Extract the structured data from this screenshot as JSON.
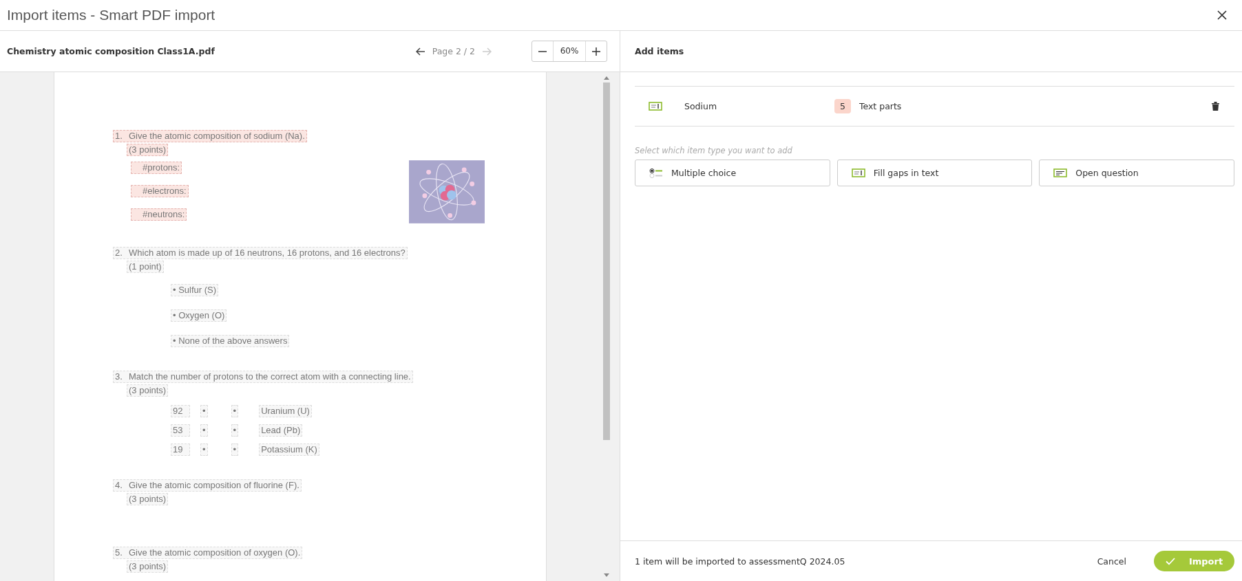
{
  "window": {
    "title": "Import items - Smart PDF import"
  },
  "pdf": {
    "file_name": "Chemistry atomic composition Class1A.pdf",
    "page_label": "Page 2 / 2",
    "prev_disabled": false,
    "next_disabled": true,
    "zoom": "60%",
    "questions": [
      {
        "number": "1.",
        "text": "Give the atomic composition of sodium (Na).",
        "points": "(3 points)",
        "highlighted": true,
        "kind": "gaps",
        "gaps": [
          {
            "label": "#protons:",
            "highlighted": true
          },
          {
            "label": "#electrons:",
            "highlighted": true
          },
          {
            "label": "#neutrons:",
            "highlighted": true
          }
        ]
      },
      {
        "number": "2.",
        "text": "Which atom is made up of 16 neutrons, 16 protons, and 16 electrons?",
        "points": "(1 point)",
        "highlighted": false,
        "kind": "options",
        "options": [
          "• Sulfur (S)",
          "• Oxygen (O)",
          "• None of the above answers"
        ]
      },
      {
        "number": "3.",
        "text": "Match the number of protons to the correct atom with a connecting line.",
        "points": "(3 points)",
        "highlighted": false,
        "kind": "matching",
        "pairs": [
          {
            "number": "92",
            "left_mark": "•",
            "right_mark": "•",
            "atom": "Uranium (U)"
          },
          {
            "number": "53",
            "left_mark": "•",
            "right_mark": "•",
            "atom": "Lead (Pb)"
          },
          {
            "number": "19",
            "left_mark": "•",
            "right_mark": "•",
            "atom": "Potassium (K)"
          }
        ]
      },
      {
        "number": "4.",
        "text": "Give the atomic composition of fluorine (F).",
        "points": "(3 points)",
        "highlighted": false,
        "kind": "plain"
      },
      {
        "number": "5.",
        "text": "Give the atomic composition of oxygen (O).",
        "points": "(3 points)",
        "highlighted": false,
        "kind": "plain"
      }
    ]
  },
  "add_items": {
    "title": "Add items",
    "items": [
      {
        "kind": "fill_gaps",
        "name": "Sodium",
        "count": "5",
        "count_label": "Text parts"
      }
    ],
    "hint": "Select which item type you want to add",
    "types": [
      {
        "kind": "multiple_choice",
        "label": "Multiple choice"
      },
      {
        "kind": "fill_gaps",
        "label": "Fill gaps in text"
      },
      {
        "kind": "open",
        "label": "Open question"
      }
    ]
  },
  "footer": {
    "summary": "1 item will be imported to assessmentQ 2024.05",
    "cancel": "Cancel",
    "import": "Import"
  }
}
